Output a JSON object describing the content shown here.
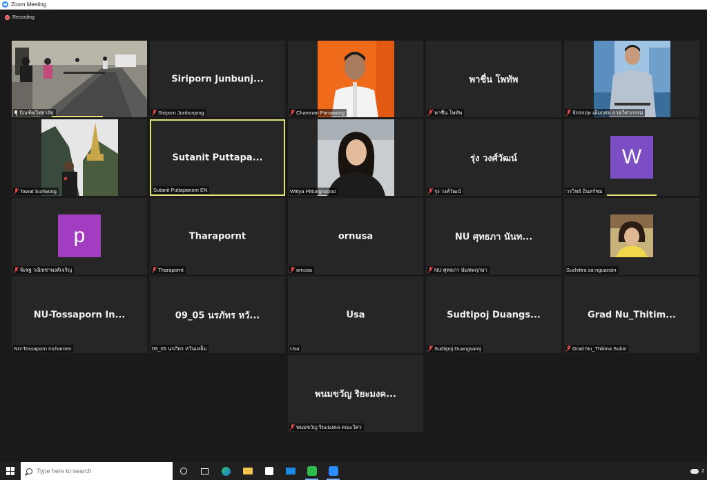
{
  "window": {
    "title": "Zoom Meeting"
  },
  "recording": {
    "label": "Recording"
  },
  "participants": [
    {
      "id": "p1",
      "big_name": "",
      "label": "ปัณฑิตวิทยาลัย",
      "status": "pinned"
    },
    {
      "id": "p2",
      "big_name": "Siriporn  Junbunj...",
      "label": "Siriporn Junbunjong",
      "status": "muted"
    },
    {
      "id": "p3",
      "big_name": "",
      "label": "Chamnan Panawong",
      "status": "muted"
    },
    {
      "id": "p4",
      "big_name": "พาชื่น โพทัพ",
      "label": "พาชื่น โพทัพ",
      "status": "muted"
    },
    {
      "id": "p5",
      "big_name": "",
      "label": "จักรกฤษ เต็มกุศล ภาควิศวกรรม",
      "status": "muted"
    },
    {
      "id": "p6",
      "big_name": "",
      "label": "Tawat Suriwong",
      "status": "muted"
    },
    {
      "id": "p7",
      "big_name": "Sutanit  Puttapa...",
      "label": "Sutanit Puttapanom EN",
      "status": "active"
    },
    {
      "id": "p8",
      "big_name": "",
      "label": "Witiya Pittungnapoo",
      "status": "none"
    },
    {
      "id": "p9",
      "big_name": "รุ่ง  วงศ์วัฒน์",
      "label": "รุ่ง  วงศ์วัฒน์",
      "status": "muted"
    },
    {
      "id": "p10",
      "big_name": "",
      "avatar_letter": "W",
      "label": "วรวิทย์ อินทร์ชม",
      "status": "none"
    },
    {
      "id": "p11",
      "big_name": "",
      "avatar_letter": "p",
      "label": "พิเชฐ วณิชชาพงศ์เจริญ",
      "status": "muted"
    },
    {
      "id": "p12",
      "big_name": "Tharapornt",
      "label": "Tharapornt",
      "status": "muted"
    },
    {
      "id": "p13",
      "big_name": "ornusa",
      "label": "ornusa",
      "status": "muted"
    },
    {
      "id": "p14",
      "big_name": "NU ศุทธภา  นันท...",
      "label": "NU ศุทธภา  นันทพฤกษา",
      "status": "muted"
    },
    {
      "id": "p15",
      "big_name": "",
      "label": "Suchittra sa-nguansin",
      "status": "none"
    },
    {
      "id": "p16",
      "big_name": "NU-Tossaporn  In...",
      "label": "NU-Tossaporn Incharoen",
      "status": "none"
    },
    {
      "id": "p17",
      "big_name": "09_05 นรภัทร หวั...",
      "label": "09_05 นรภัทร หวันเหล็ม",
      "status": "none"
    },
    {
      "id": "p18",
      "big_name": "Usa",
      "label": "Usa",
      "status": "none"
    },
    {
      "id": "p19",
      "big_name": "Sudtipoj  Duangs...",
      "label": "Sudtipoj Duangsaroj",
      "status": "muted"
    },
    {
      "id": "p20",
      "big_name": "Grad  Nu_Thitim...",
      "label": "Grad Nu_Thitima Subin",
      "status": "muted"
    },
    {
      "id": "p21",
      "big_name": "พนมขวัญ ริยะมงค...",
      "label": "พนมขวัญ ริยะมงคล คณะวิศว",
      "status": "muted"
    }
  ],
  "taskbar": {
    "search_placeholder": "Type here to search",
    "tray_text": "2"
  },
  "colors": {
    "active_border": "#e6e27a",
    "muted_mic": "#e34b4b",
    "avatar_w": "#7b4ec4",
    "avatar_p": "#a23cc1"
  }
}
